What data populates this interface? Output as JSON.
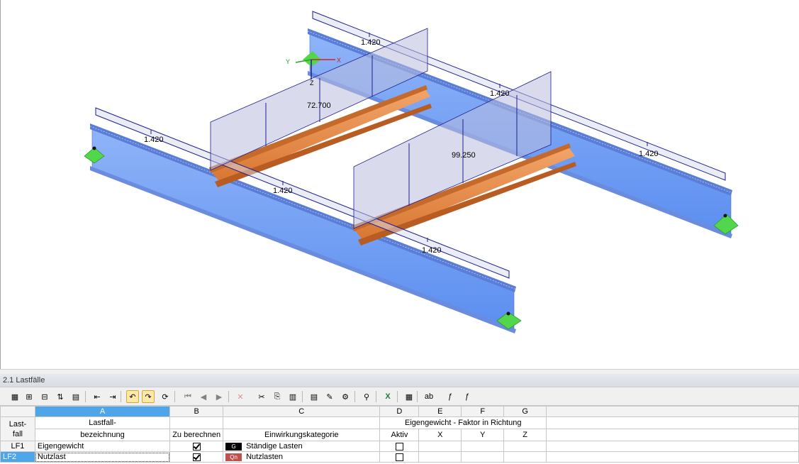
{
  "model": {
    "axes": {
      "x": "X",
      "y": "Y",
      "z": "Z"
    },
    "load_labels": [
      "1.420",
      "1.420",
      "1.420",
      "1.420",
      "1.420",
      "1.420",
      "72.700",
      "99.250"
    ],
    "colors": {
      "beam_main": "#6f9ef5",
      "beam_cross": "#e38b4c",
      "load": "#1f1f8c",
      "support": "#52d64b"
    }
  },
  "panel": {
    "title": "2.1 Lastfälle"
  },
  "toolbar": {
    "icons": [
      "table-icon",
      "insert-row-icon",
      "delete-row-icon",
      "move-row-icon",
      "chart-icon",
      "import-icon",
      "export-icon",
      "undo-icon",
      "redo-icon",
      "refresh-icon",
      "first-icon",
      "prev-icon",
      "next-icon",
      "delete-icon",
      "cut-icon",
      "paste-icon",
      "columns-icon",
      "rows-icon",
      "edit-icon",
      "settings-icon",
      "filter-icon",
      "excel-icon",
      "calculator-icon",
      "ab-icon",
      "function-icon",
      "clear-function-icon"
    ]
  },
  "table": {
    "columns": [
      "A",
      "B",
      "C",
      "D",
      "E",
      "F",
      "G"
    ],
    "row_header_title_1": "Last-",
    "row_header_title_2": "fall",
    "col_a_line1": "Lastfall-",
    "col_a_line2": "bezeichnung",
    "col_b_line2": "Zu berechnen",
    "col_c_line2": "Einwirkungskategorie",
    "col_defg_group": "Eigengewicht  -  Faktor in Richtung",
    "col_d_line2": "Aktiv",
    "col_e_line2": "X",
    "col_f_line2": "Y",
    "col_g_line2": "Z",
    "rows": [
      {
        "id": "LF1",
        "name": "Eigengewicht",
        "compute": true,
        "cat_code": "G",
        "cat_color": "#000000",
        "category": "Ständige Lasten",
        "active": false
      },
      {
        "id": "LF2",
        "name": "Nutzlast",
        "compute": true,
        "cat_code": "Qn",
        "cat_color": "#c0504d",
        "category": "Nutzlasten",
        "active": false
      }
    ]
  }
}
